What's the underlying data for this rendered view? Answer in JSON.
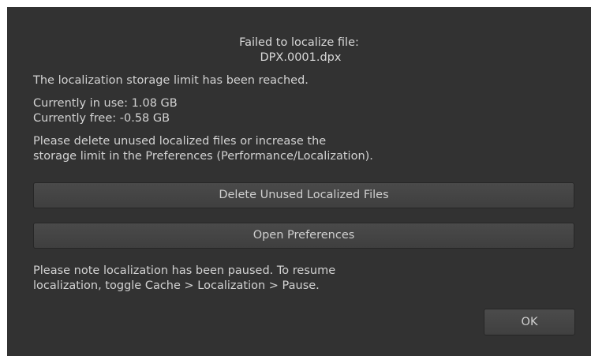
{
  "dialog": {
    "title_line1": "Failed to localize file:",
    "title_line2": "DPX.0001.dpx",
    "message_limit": "The localization storage limit has been reached.",
    "in_use": "Currently in use: 1.08 GB",
    "free": "Currently free: -0.58 GB",
    "instruction_line1": "Please delete unused localized files or increase the",
    "instruction_line2": "storage limit in the Preferences (Performance/Localization).",
    "delete_button_label": "Delete Unused Localized Files",
    "preferences_button_label": "Open Preferences",
    "note_line1": "Please note localization has been paused. To resume",
    "note_line2": "localization, toggle Cache > Localization > Pause.",
    "ok_button_label": "OK"
  },
  "colors": {
    "background": "#323232",
    "text": "#d6d6d6",
    "button": "#464646"
  }
}
